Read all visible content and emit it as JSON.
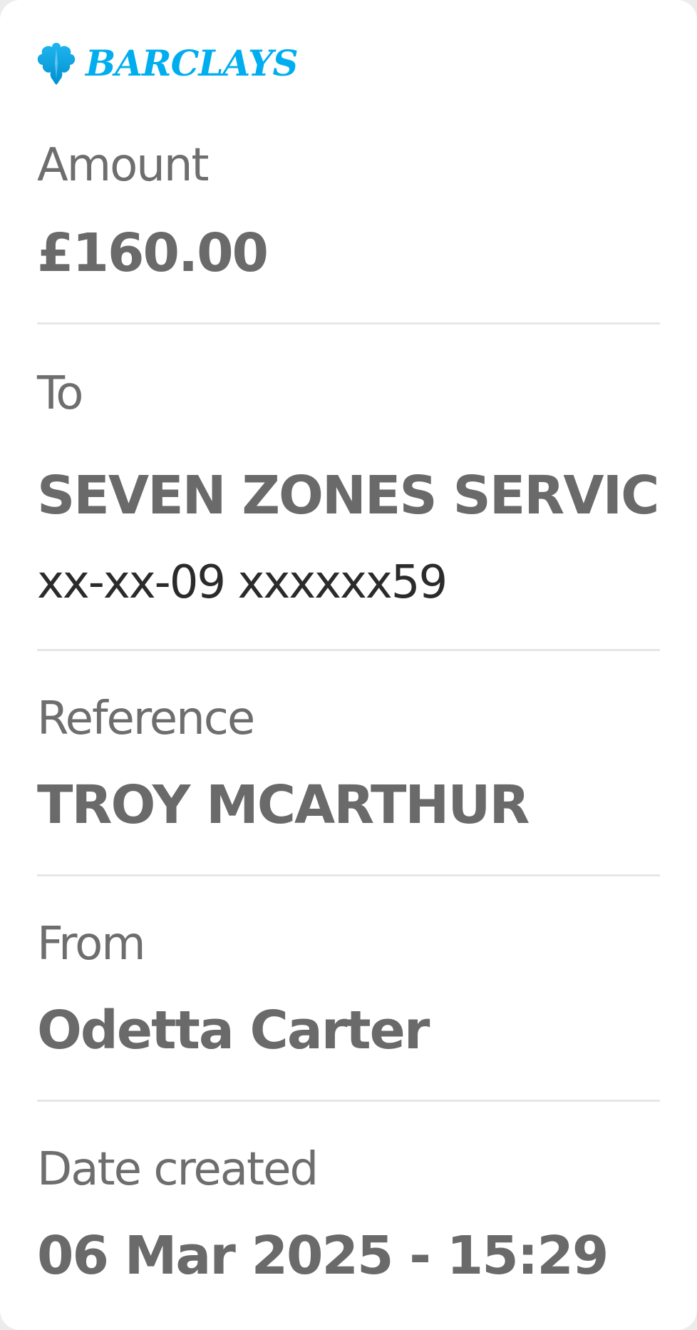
{
  "brand": {
    "name": "BARCLAYS",
    "logo_icon": "eagle-icon",
    "color": "#00aeef"
  },
  "fields": {
    "amount": {
      "label": "Amount",
      "value": "£160.00"
    },
    "to": {
      "label": "To",
      "value": "SEVEN ZONES SERVIC",
      "account": "xx-xx-09 xxxxxx59"
    },
    "reference": {
      "label": "Reference",
      "value": "TROY MCARTHUR"
    },
    "from": {
      "label": "From",
      "value": "Odetta Carter"
    },
    "date_created": {
      "label": "Date created",
      "value": "06 Mar 2025 - 15:29"
    }
  },
  "colors": {
    "label_text": "#6e6e6e",
    "value_text": "#6a6a6a",
    "account_text": "#2b2b2b",
    "divider": "#e6e6e6"
  }
}
